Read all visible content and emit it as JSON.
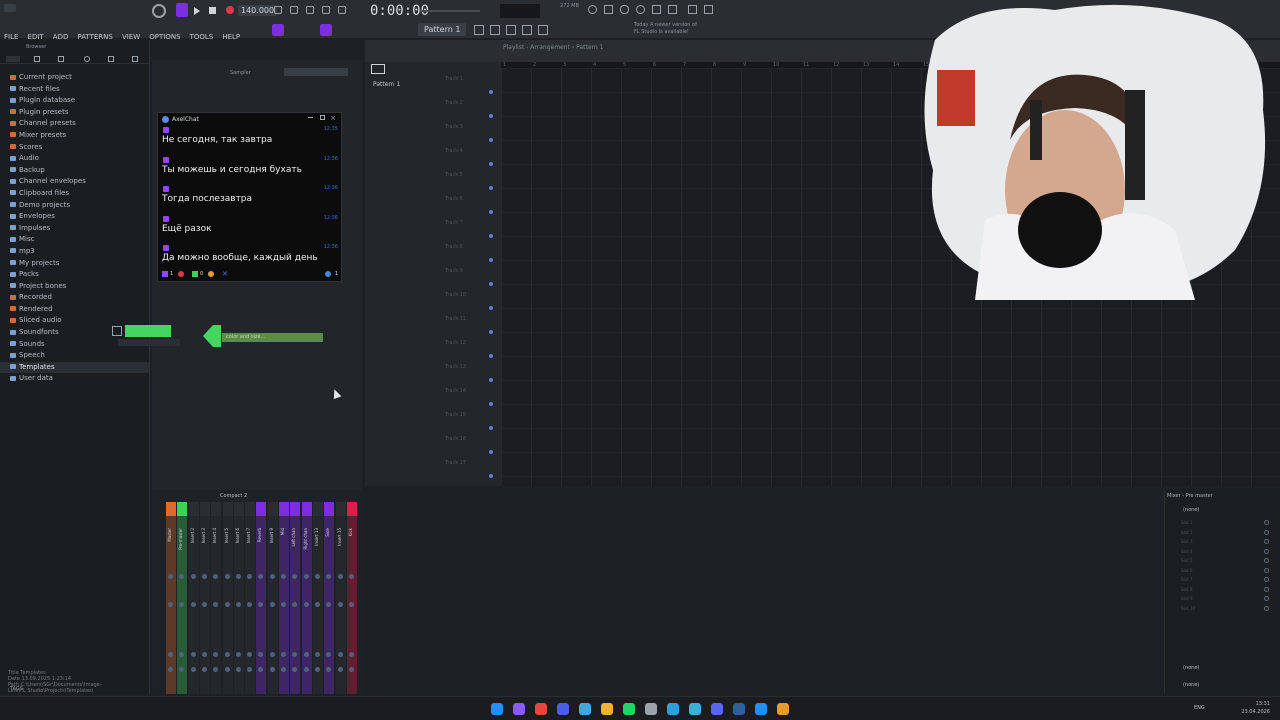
{
  "menu": {
    "items": [
      "FILE",
      "EDIT",
      "ADD",
      "PATTERNS",
      "VIEW",
      "OPTIONS",
      "TOOLS",
      "HELP"
    ]
  },
  "transport": {
    "time": "0:00:00",
    "tempo": "140.000",
    "pattern": "Pattern 1",
    "ram": "272 MB",
    "hint_line1": "Today  A newer version of",
    "hint_line2": "FL Studio is available!"
  },
  "browser": {
    "title": "Browser",
    "items": [
      {
        "label": "Current project",
        "icon_color": "#d26a3b"
      },
      {
        "label": "Recent files",
        "icon_color": "#7aa0d6"
      },
      {
        "label": "Plugin database",
        "icon_color": "#7aa0d6"
      },
      {
        "label": "Plugin presets",
        "icon_color": "#d26a3b"
      },
      {
        "label": "Channel presets",
        "icon_color": "#d26a3b"
      },
      {
        "label": "Mixer presets",
        "icon_color": "#d26a3b"
      },
      {
        "label": "Scores",
        "icon_color": "#d26a3b"
      },
      {
        "label": "Audio",
        "icon_color": "#7aa0d6"
      },
      {
        "label": "Backup",
        "icon_color": "#7aa0d6"
      },
      {
        "label": "Channel envelopes",
        "icon_color": "#7aa0d6"
      },
      {
        "label": "Clipboard files",
        "icon_color": "#7aa0d6"
      },
      {
        "label": "Demo projects",
        "icon_color": "#7aa0d6"
      },
      {
        "label": "Envelopes",
        "icon_color": "#7aa0d6"
      },
      {
        "label": "Impulses",
        "icon_color": "#7aa0d6"
      },
      {
        "label": "Misc",
        "icon_color": "#7aa0d6"
      },
      {
        "label": "mp3",
        "icon_color": "#7aa0d6"
      },
      {
        "label": "My projects",
        "icon_color": "#7aa0d6"
      },
      {
        "label": "Packs",
        "icon_color": "#7aa0d6"
      },
      {
        "label": "Project bones",
        "icon_color": "#7aa0d6"
      },
      {
        "label": "Recorded",
        "icon_color": "#d26a3b"
      },
      {
        "label": "Rendered",
        "icon_color": "#d26a3b"
      },
      {
        "label": "Sliced audio",
        "icon_color": "#d26a3b"
      },
      {
        "label": "Soundfonts",
        "icon_color": "#7aa0d6"
      },
      {
        "label": "Sounds",
        "icon_color": "#7aa0d6"
      },
      {
        "label": "Speech",
        "icon_color": "#7aa0d6"
      },
      {
        "label": "Templates",
        "icon_color": "#7aa0d6"
      },
      {
        "label": "User data",
        "icon_color": "#7aa0d6"
      }
    ],
    "info_title": "Title   Templates",
    "info_date": "Date   13.09.2025 1:23:14",
    "info_path": "Path   C:\\Users\\SGr\\Documents\\Image-Line\\FL Studio\\Projects\\Templates\\",
    "tags_label": "TAGS"
  },
  "channel_rack": {
    "sampler_label": "Sampler",
    "green_strip_text": "color and size..."
  },
  "chat": {
    "title": "AxelChat",
    "messages": [
      {
        "time": "12:35",
        "text": "Не сегодня, так завтра"
      },
      {
        "time": "12:36",
        "text": "Ты можешь и сегодня бухать"
      },
      {
        "time": "12:36",
        "text": "Тогда послезавтра"
      },
      {
        "time": "12:36",
        "text": "Ещё разок"
      },
      {
        "time": "12:36",
        "text": "Да можно вообще, каждый день"
      }
    ],
    "footer_count_left": "1",
    "footer_count_mid": "0",
    "footer_count_right": "1"
  },
  "playlist": {
    "title": "Playlist - Arrangement  ›  Pattern 1",
    "pattern_item": "Pattern 1",
    "ruler": [
      "1",
      "2",
      "3",
      "4",
      "5",
      "6",
      "7",
      "8",
      "9",
      "10",
      "11",
      "12",
      "13",
      "14",
      "15",
      "16",
      "17",
      "18",
      "19",
      "20",
      "21",
      "22",
      "23",
      "24",
      "25",
      "26"
    ],
    "tracks": [
      "Track 1",
      "Track 2",
      "Track 3",
      "Track 4",
      "Track 5",
      "Track 6",
      "Track 7",
      "Track 8",
      "Track 9",
      "Track 10",
      "Track 11",
      "Track 12",
      "Track 13",
      "Track 14",
      "Track 15",
      "Track 16",
      "Track 17"
    ]
  },
  "mixer": {
    "title": "Compact 2",
    "strips": [
      {
        "label": "Master",
        "color": "#e06a2c"
      },
      {
        "label": "Pre-master",
        "color": "#3fd05a"
      },
      {
        "label": "Insert 2",
        "color": "#2a2e33"
      },
      {
        "label": "Insert 3",
        "color": "#2a2e33"
      },
      {
        "label": "Insert 4",
        "color": "#2a2e33"
      },
      {
        "label": "Insert 5",
        "color": "#2a2e33"
      },
      {
        "label": "Insert 6",
        "color": "#2a2e33"
      },
      {
        "label": "Insert 7",
        "color": "#2a2e33"
      },
      {
        "label": "Reverb",
        "color": "#7b2fe0"
      },
      {
        "label": "Insert 9",
        "color": "#2a2e33"
      },
      {
        "label": "Mid",
        "color": "#7b2fe0"
      },
      {
        "label": "Left chan",
        "color": "#7b2fe0"
      },
      {
        "label": "Right chan",
        "color": "#7b2fe0"
      },
      {
        "label": "Insert 13",
        "color": "#2a2e33"
      },
      {
        "label": "Side",
        "color": "#7b2fe0"
      },
      {
        "label": "Insert 15",
        "color": "#2a2e33"
      },
      {
        "label": "Kick",
        "color": "#e01c4a"
      }
    ]
  },
  "insert_panel": {
    "title": "Mixer - Pre master",
    "top_slot": "(none)",
    "slots": [
      "Slot 1",
      "Slot 2",
      "Slot 3",
      "Slot 4",
      "Slot 5",
      "Slot 6",
      "Slot 7",
      "Slot 8",
      "Slot 9",
      "Slot 10"
    ],
    "bottom_slot_1": "(none)",
    "bottom_slot_2": "(none)"
  },
  "taskbar": {
    "lang": "ENG",
    "time": "13:31",
    "date": "23.04.2026",
    "icon_colors": [
      "#1e90ff",
      "#8a5cf6",
      "#e8463c",
      "#4a5de8",
      "#3fa7e0",
      "#f0b428",
      "#1ed760",
      "#9aa3ab",
      "#2aa0e0",
      "#38b0d8",
      "#5865f2",
      "#2f5f9a",
      "#1e90ff",
      "#e89a2c"
    ]
  }
}
